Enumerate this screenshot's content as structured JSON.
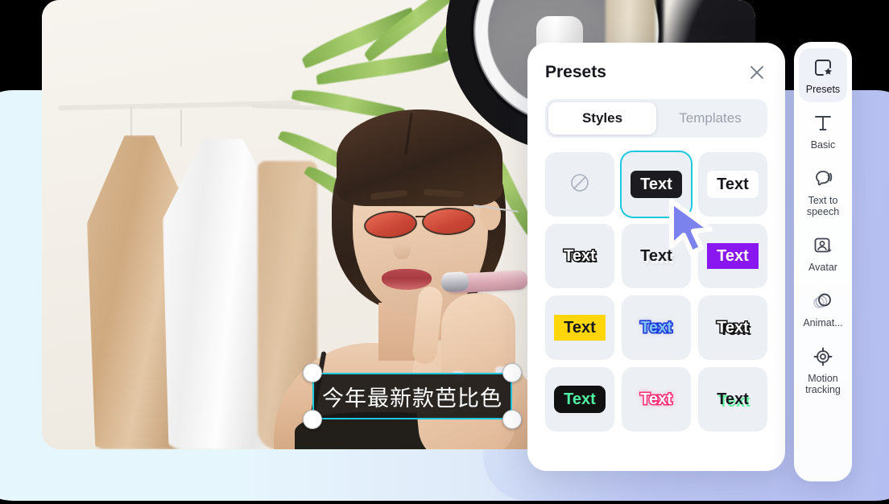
{
  "canvas": {
    "overlay_text": "今年最新款芭比色",
    "selection_border_color": "#1ec8e0"
  },
  "presets_panel": {
    "title": "Presets",
    "close_icon": "close-icon",
    "tabs": [
      {
        "label": "Styles",
        "active": true
      },
      {
        "label": "Templates",
        "active": false
      }
    ],
    "styles": [
      {
        "label": "",
        "style": "none",
        "selected": false,
        "icon": "no-style-icon"
      },
      {
        "label": "Text",
        "style": "dark",
        "selected": true
      },
      {
        "label": "Text",
        "style": "white",
        "selected": false
      },
      {
        "label": "Text",
        "style": "outline",
        "selected": false
      },
      {
        "label": "Text",
        "style": "shadow",
        "selected": false
      },
      {
        "label": "Text",
        "style": "purple",
        "selected": false
      },
      {
        "label": "Text",
        "style": "yellow",
        "selected": false
      },
      {
        "label": "Text",
        "style": "blue",
        "selected": false
      },
      {
        "label": "Text",
        "style": "white-outline",
        "selected": false
      },
      {
        "label": "Text",
        "style": "green-pill",
        "selected": false
      },
      {
        "label": "Text",
        "style": "pink-neon",
        "selected": false
      },
      {
        "label": "Text",
        "style": "green-shadow",
        "selected": false
      }
    ]
  },
  "toolbar": {
    "items": [
      {
        "label": "Presets",
        "icon": "presets-icon",
        "active": true
      },
      {
        "label": "Basic",
        "icon": "text-basic-icon",
        "active": false
      },
      {
        "label": "Text to speech",
        "icon": "text-to-speech-icon",
        "active": false
      },
      {
        "label": "Avatar",
        "icon": "avatar-icon",
        "active": false
      },
      {
        "label": "Animat...",
        "icon": "animation-icon",
        "active": false
      },
      {
        "label": "Motion tracking",
        "icon": "motion-tracking-icon",
        "active": false
      }
    ]
  },
  "colors": {
    "accent_cyan": "#1ec8e0",
    "cursor": "#7b82ee",
    "panel_bg": "#ffffff",
    "tile_bg": "#eceff4"
  }
}
